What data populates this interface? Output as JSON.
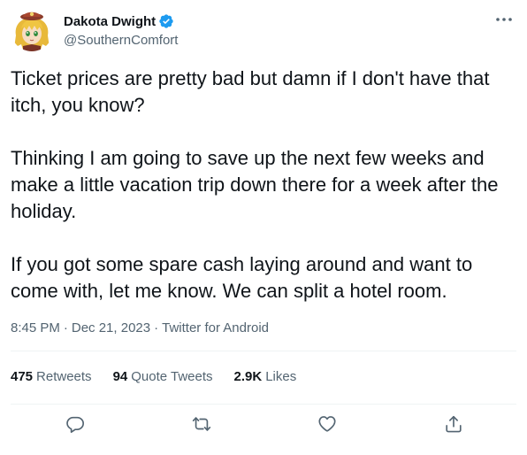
{
  "author": {
    "display_name": "Dakota Dwight",
    "handle": "@SouthernComfort",
    "verified": true,
    "avatar": "avatar-image",
    "verified_icon": "verified-badge-icon"
  },
  "more_icon": "more-options-icon",
  "tweet": {
    "paragraphs": [
      "Ticket prices are pretty bad but damn if I don't have that itch, you know?",
      "Thinking I am going to save up the next few weeks and make a little vacation trip down there for a week after the holiday.",
      "If you got some spare cash laying around and want to come with, let me know. We can split a hotel room."
    ]
  },
  "meta": {
    "time": "8:45 PM",
    "separator1": "·",
    "date": "Dec 21, 2023",
    "separator2": "·",
    "source": "Twitter for Android"
  },
  "stats": {
    "retweets_count": "475",
    "retweets_label": "Retweets",
    "quotes_count": "94",
    "quotes_label": "Quote Tweets",
    "likes_count": "2.9K",
    "likes_label": "Likes"
  },
  "actions": {
    "reply_icon": "reply-icon",
    "retweet_icon": "retweet-icon",
    "like_icon": "heart-icon",
    "share_icon": "share-icon"
  },
  "colors": {
    "text_primary": "#0f1419",
    "text_secondary": "#536471",
    "verified_blue": "#1d9bf0",
    "divider": "#eff3f4"
  }
}
